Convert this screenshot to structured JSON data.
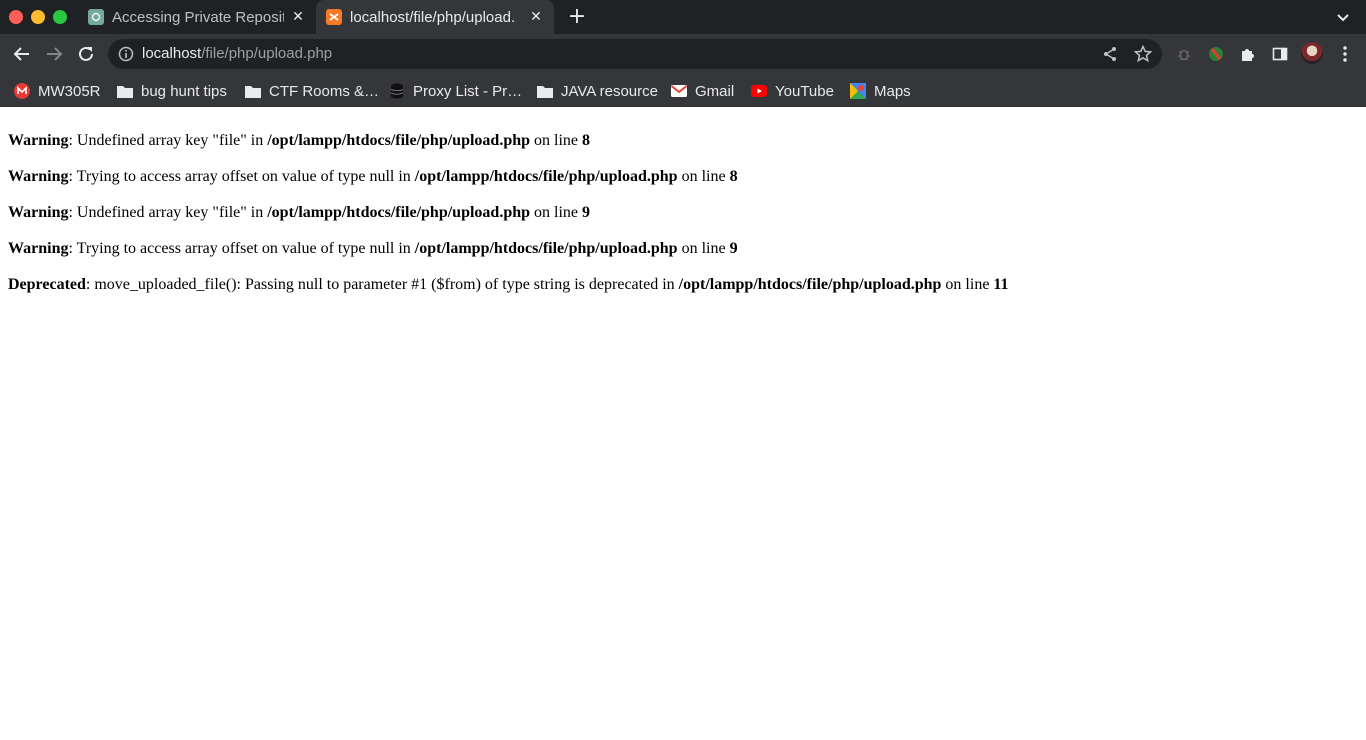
{
  "tabs": [
    {
      "title": "Accessing Private Reposito",
      "icon": "chatgpt-favicon",
      "active": false
    },
    {
      "title": "localhost/file/php/upload.",
      "icon": "xampp-favicon",
      "active": true
    }
  ],
  "new_tab_label": "+",
  "toolbar": {
    "url_host": "localhost",
    "url_path": "/file/php/upload.php"
  },
  "bookmarks": [
    {
      "label": "MW305R",
      "icon": "mercusys-icon"
    },
    {
      "label": "bug hunt tips",
      "icon": "folder-icon"
    },
    {
      "label": "CTF Rooms &…",
      "icon": "folder-icon"
    },
    {
      "label": "Proxy List - Pr…",
      "icon": "database-icon"
    },
    {
      "label": "JAVA resource",
      "icon": "folder-icon"
    },
    {
      "label": "Gmail",
      "icon": "gmail-icon"
    },
    {
      "label": "YouTube",
      "icon": "youtube-icon"
    },
    {
      "label": "Maps",
      "icon": "maps-icon"
    }
  ],
  "messages": [
    {
      "level": "Warning",
      "text": ": Undefined array key \"file\" in ",
      "path": "/opt/lampp/htdocs/file/php/upload.php",
      "on_line": " on line ",
      "line": "8"
    },
    {
      "level": "Warning",
      "text": ": Trying to access array offset on value of type null in ",
      "path": "/opt/lampp/htdocs/file/php/upload.php",
      "on_line": " on line ",
      "line": "8"
    },
    {
      "level": "Warning",
      "text": ": Undefined array key \"file\" in ",
      "path": "/opt/lampp/htdocs/file/php/upload.php",
      "on_line": " on line ",
      "line": "9"
    },
    {
      "level": "Warning",
      "text": ": Trying to access array offset on value of type null in ",
      "path": "/opt/lampp/htdocs/file/php/upload.php",
      "on_line": " on line ",
      "line": "9"
    },
    {
      "level": "Deprecated",
      "text": ": move_uploaded_file(): Passing null to parameter #1 ($from) of type string is deprecated in ",
      "path": "/opt/lampp/htdocs/file/php/upload.php",
      "on_line": " on line ",
      "line": "11"
    }
  ],
  "colors": {
    "tabstrip": "#202124",
    "toolbar": "#35363a",
    "text_light": "#e8eaed",
    "page_bg": "#ffffff"
  }
}
